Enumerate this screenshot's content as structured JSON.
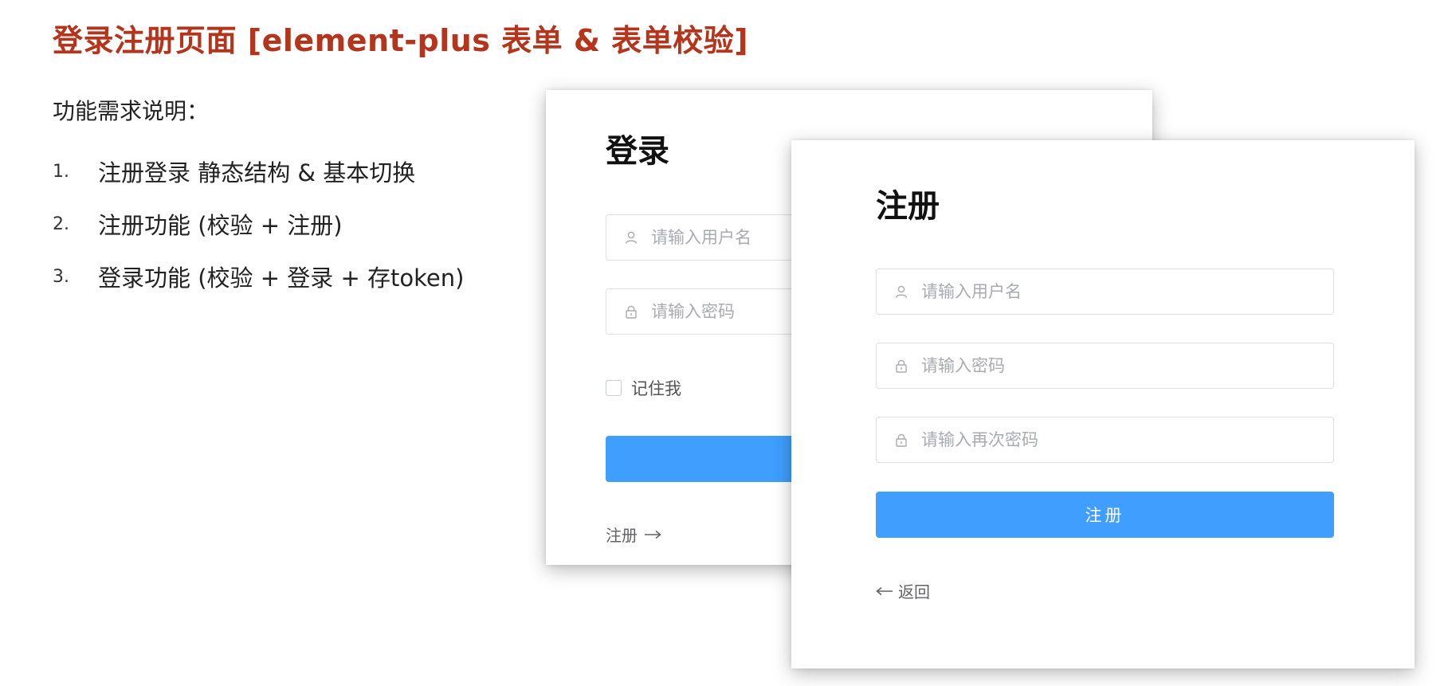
{
  "slide": {
    "title": "登录注册页面 [element-plus 表单 & 表单校验]",
    "requirements_heading": "功能需求说明：",
    "requirements": [
      {
        "number": "1.",
        "text": "注册登录 静态结构 & 基本切换"
      },
      {
        "number": "2.",
        "text": "注册功能 (校验 + 注册)"
      },
      {
        "number": "3.",
        "text": "登录功能 (校验 + 登录 + 存token)"
      }
    ]
  },
  "login_form": {
    "title": "登录",
    "username_placeholder": "请输入用户名",
    "password_placeholder": "请输入密码",
    "remember_label": "记住我",
    "submit_label": "",
    "switch_link": "注册"
  },
  "register_form": {
    "title": "注册",
    "username_placeholder": "请输入用户名",
    "password_placeholder": "请输入密码",
    "repassword_placeholder": "请输入再次密码",
    "submit_label": "注册",
    "back_link": "返回"
  },
  "colors": {
    "title_red": "#b5341c",
    "primary_blue": "#409eff",
    "border": "#dcdfe6",
    "placeholder": "#a8abb2"
  },
  "icons": {
    "user": "user-icon",
    "lock": "lock-icon",
    "arrow_right": "arrow-right-icon",
    "arrow_left": "arrow-left-icon"
  }
}
